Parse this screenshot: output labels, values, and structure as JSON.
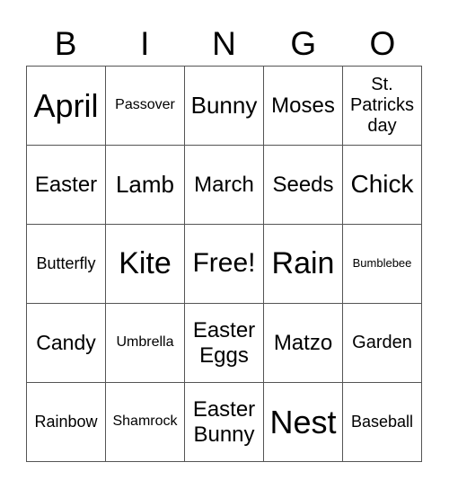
{
  "header": [
    "B",
    "I",
    "N",
    "G",
    "O"
  ],
  "cells": [
    [
      "April",
      "Passover",
      "Bunny",
      "Moses",
      "St. Patricks day"
    ],
    [
      "Easter",
      "Lamb",
      "March",
      "Seeds",
      "Chick"
    ],
    [
      "Butterfly",
      "Kite",
      "Free!",
      "Rain",
      "Bumblebee"
    ],
    [
      "Candy",
      "Umbrella",
      "Easter Eggs",
      "Matzo",
      "Garden"
    ],
    [
      "Rainbow",
      "Shamrock",
      "Easter Bunny",
      "Nest",
      "Baseball"
    ]
  ]
}
